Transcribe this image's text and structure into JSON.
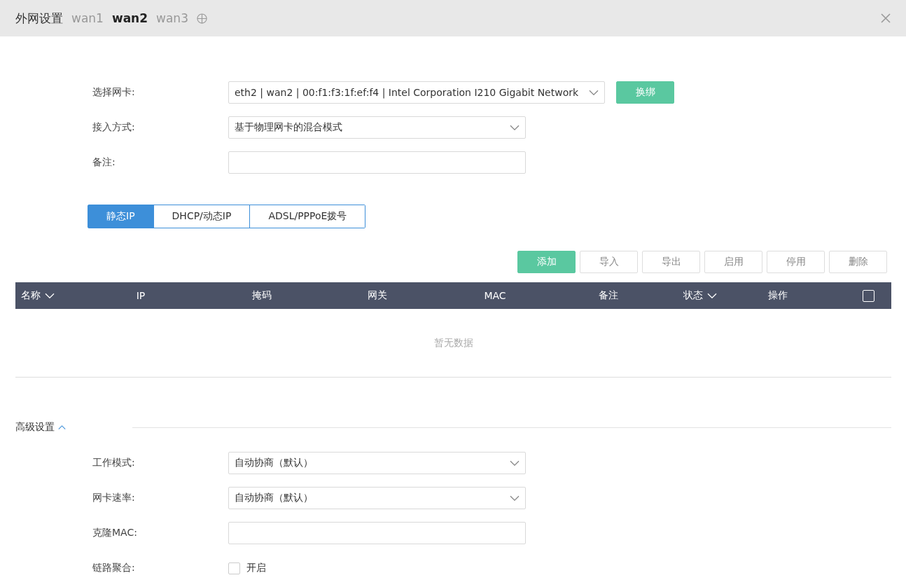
{
  "window": {
    "title": "外网设置"
  },
  "wan_tabs": [
    {
      "label": "wan1",
      "selected": false
    },
    {
      "label": "wan2",
      "selected": true
    },
    {
      "label": "wan3",
      "selected": false
    }
  ],
  "basic_fields": [
    {
      "label": "选择网卡:",
      "kind": "wide_select",
      "value": "eth2 | wan2 | 00:f1:f3:1f:ef:f4 | Intel Corporation I210 Gigabit Network",
      "action": "换绑"
    },
    {
      "label": "接入方式:",
      "kind": "select",
      "value": "基于物理网卡的混合模式"
    },
    {
      "label": "备注:",
      "kind": "input"
    }
  ],
  "mode_tabs": [
    {
      "label": "静态IP",
      "selected": true
    },
    {
      "label": "DHCP/动态IP",
      "selected": false
    },
    {
      "label": "ADSL/PPPoE拨号",
      "selected": false
    }
  ],
  "toolbar": [
    {
      "label": "添加",
      "kind": "primary"
    },
    {
      "label": "导入",
      "kind": "default"
    },
    {
      "label": "导出",
      "kind": "default"
    },
    {
      "label": "启用",
      "kind": "default"
    },
    {
      "label": "停用",
      "kind": "default"
    },
    {
      "label": "删除",
      "kind": "default"
    }
  ],
  "table": {
    "columns": [
      {
        "label": "名称",
        "sortable": true
      },
      {
        "label": "IP",
        "sortable": false
      },
      {
        "label": "掩码",
        "sortable": false
      },
      {
        "label": "网关",
        "sortable": false
      },
      {
        "label": "MAC",
        "sortable": false
      },
      {
        "label": "备注",
        "sortable": false
      },
      {
        "label": "状态",
        "sortable": true
      },
      {
        "label": "操作",
        "sortable": false
      }
    ],
    "select_all": {
      "checked": false
    },
    "empty_text": "暂无数据"
  },
  "advanced": {
    "title": "高级设置",
    "expanded": true,
    "fields": [
      {
        "label": "工作模式:",
        "kind": "select",
        "value": "自动协商（默认）"
      },
      {
        "label": "网卡速率:",
        "kind": "select",
        "value": "自动协商（默认）"
      },
      {
        "label": "克隆MAC:",
        "kind": "input"
      },
      {
        "label": "链路聚合:",
        "kind": "checkbox",
        "option": "开启",
        "checked": false
      }
    ]
  }
}
